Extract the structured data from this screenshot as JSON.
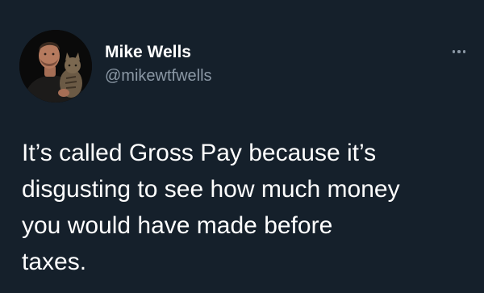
{
  "tweet": {
    "author": {
      "display_name": "Mike Wells",
      "handle": "@mikewtfwells"
    },
    "more_icon": "more-horizontal-icon",
    "text": "It’s called Gross Pay because it’s\ndisgusting to see how much money\nyou would have made before\ntaxes."
  },
  "colors": {
    "background": "#15202b",
    "text": "#ffffff",
    "secondary_text": "#8b98a5"
  }
}
